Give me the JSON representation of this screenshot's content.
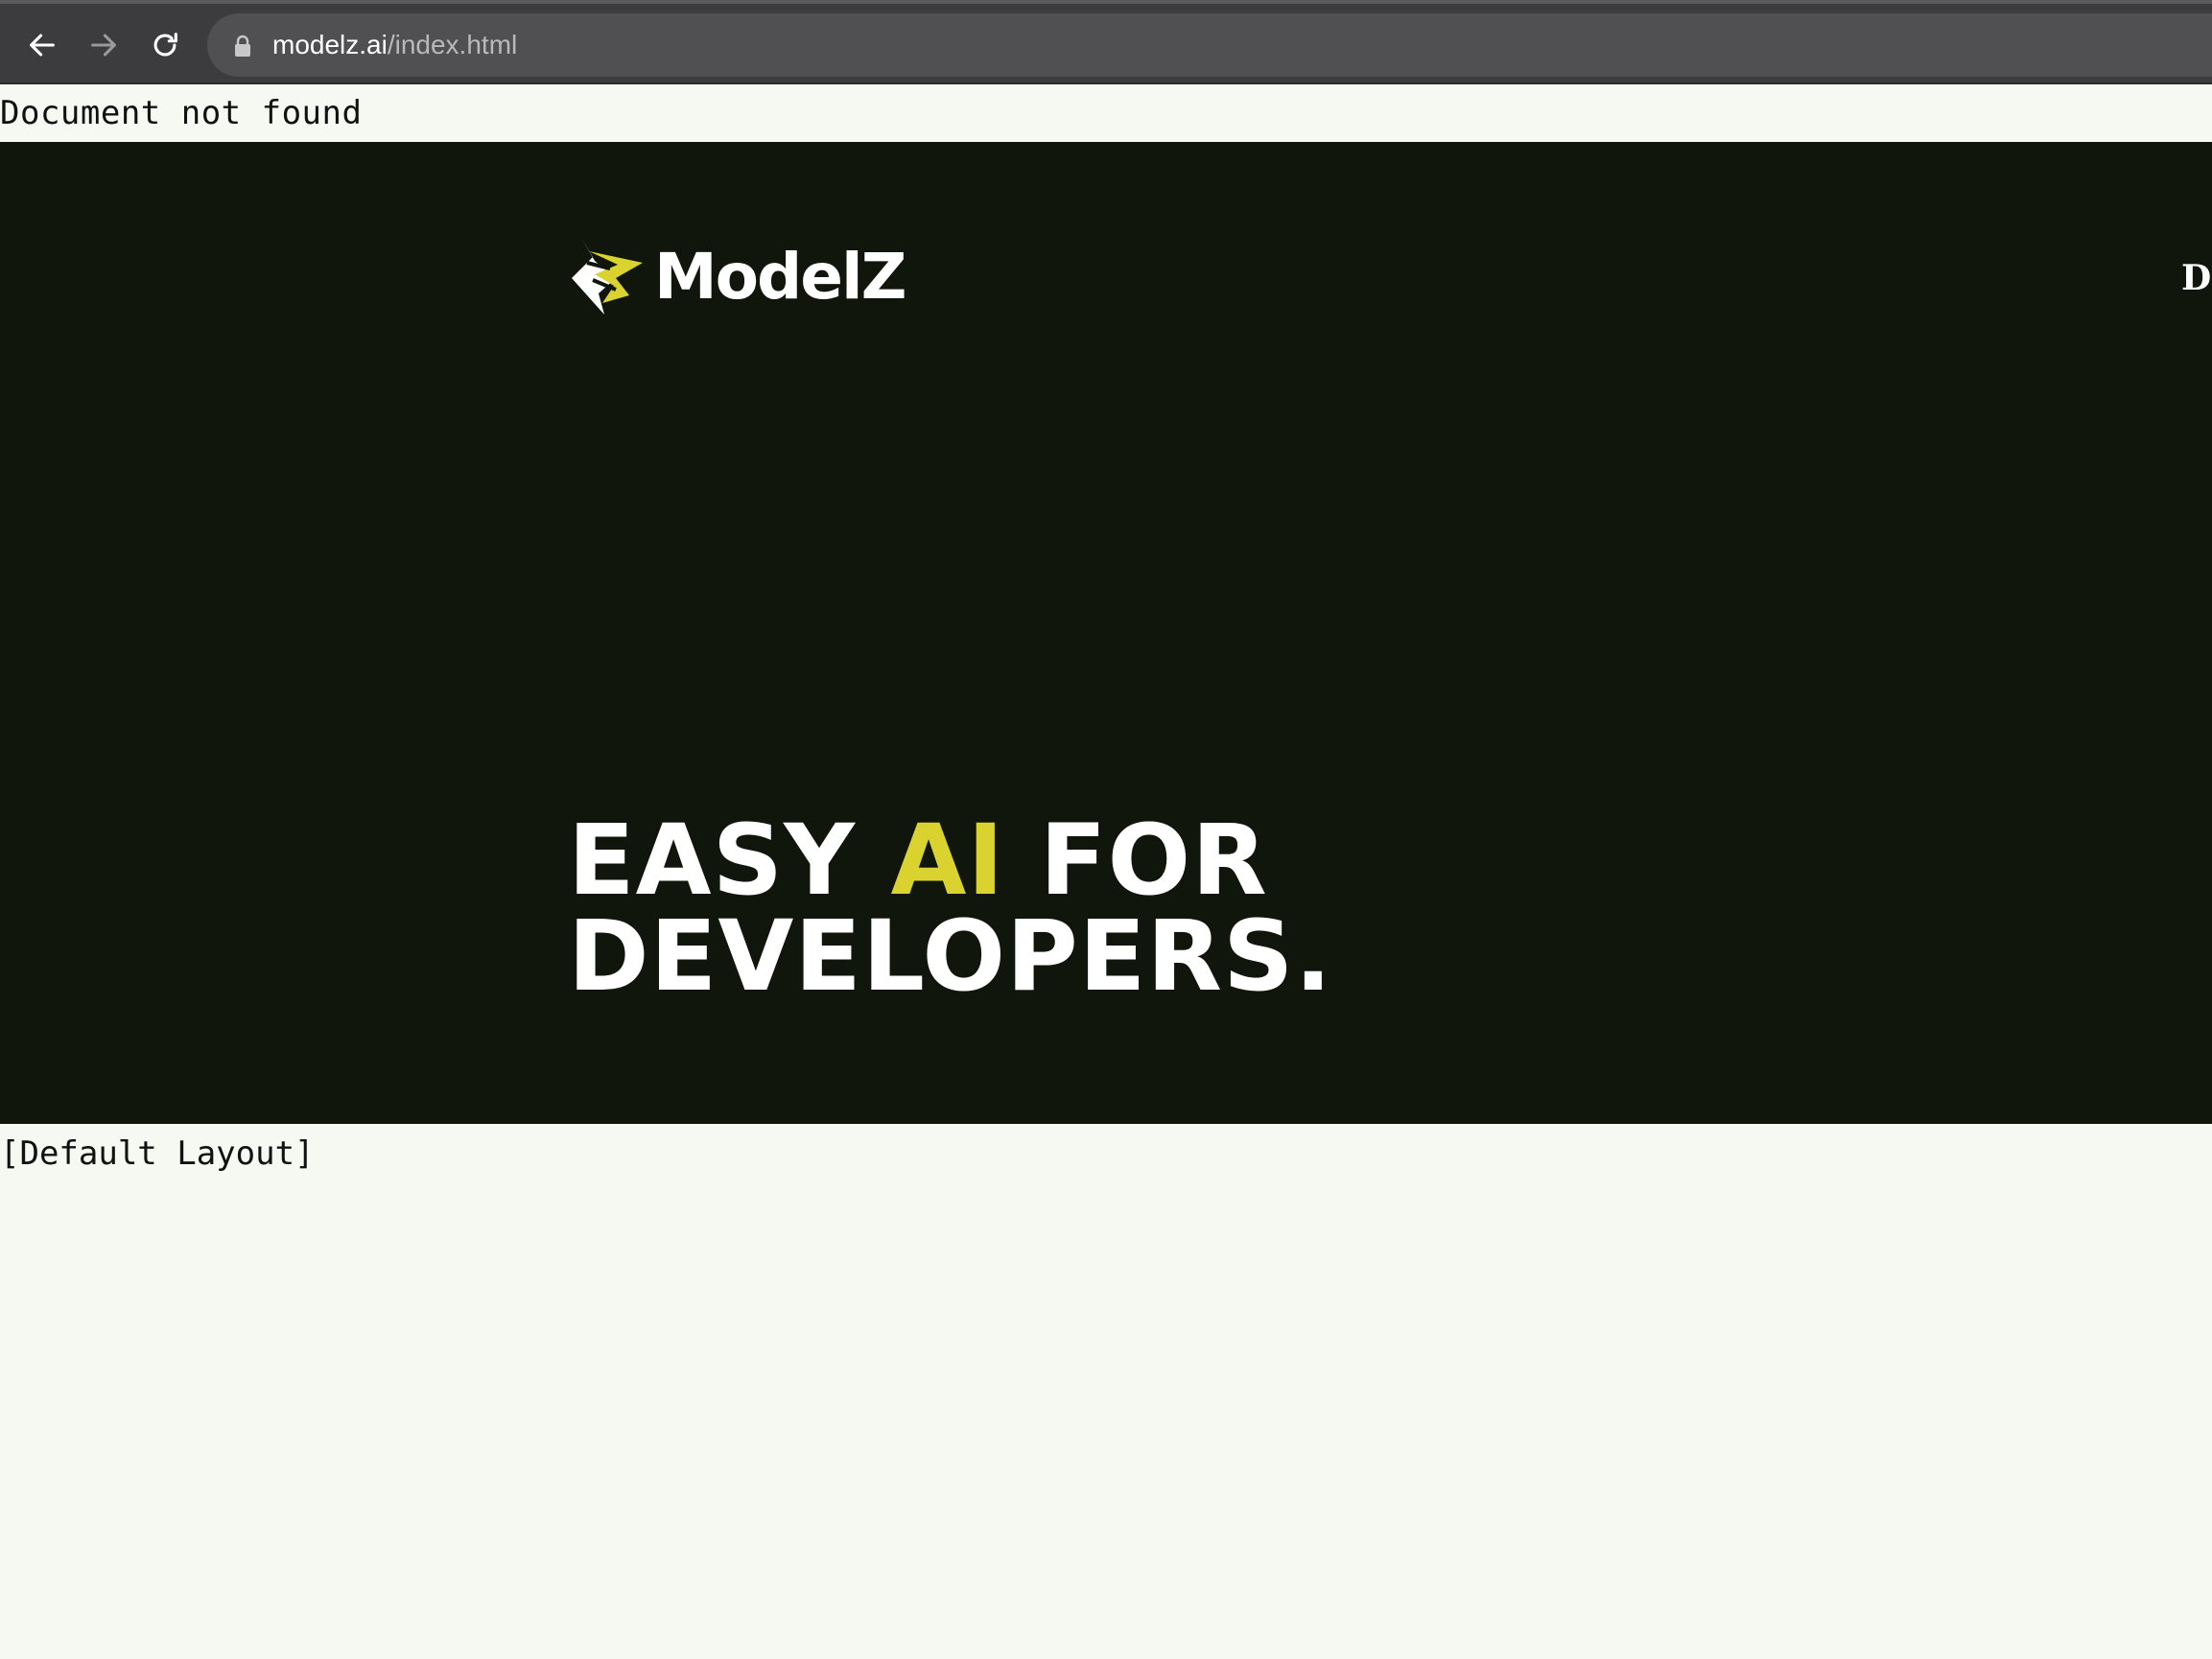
{
  "browser": {
    "url_host": "modelz.ai",
    "url_path": "/index.html",
    "icons": {
      "back": "arrow-left-icon",
      "forward": "arrow-right-icon",
      "reload": "reload-icon",
      "lock": "lock-icon"
    }
  },
  "page": {
    "error_text": "Document not found",
    "footer_text": "[Default Layout]"
  },
  "hero": {
    "logo_text": "ModelZ",
    "nav_cutoff_text": "Do",
    "headline_part1": "EASY ",
    "headline_accent": "AI",
    "headline_part2": " FOR",
    "headline_line2": "DEVELOPERS."
  },
  "colors": {
    "hero_background": "#10160b",
    "accent_yellow": "#d9d22f",
    "page_background": "#f6f9f1",
    "browser_bar": "#3c3c3e"
  }
}
